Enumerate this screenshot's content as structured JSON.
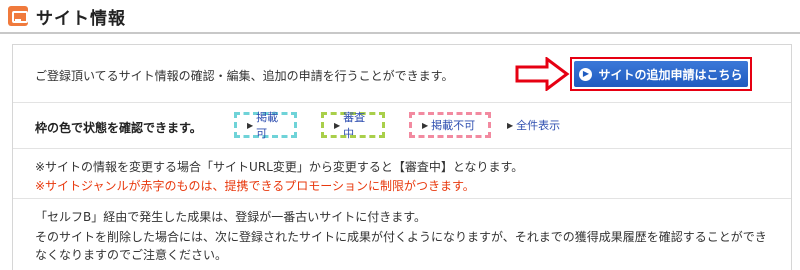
{
  "header": {
    "title": "サイト情報",
    "icon": "site-window-icon"
  },
  "colors": {
    "accent": "#f07a3c",
    "button": "#2a66cc",
    "highlight_border": "#e60012",
    "warning_text": "#e8380d",
    "link": "#2f4fb0",
    "status_ok": "#6fd3d8",
    "status_review": "#a9cf4a",
    "status_ng": "#f28aa0"
  },
  "intro": {
    "text": "ご登録頂いてるサイト情報の確認・編集、追加の申請を行うことができます。",
    "apply_button_label": "サイトの追加申請はこちら",
    "apply_button_icon": "circle-arrow-right-icon"
  },
  "status_filter": {
    "label": "枠の色で状態を確認できます。",
    "items": [
      {
        "label": "掲載可"
      },
      {
        "label": "審査中"
      },
      {
        "label": "掲載不可"
      },
      {
        "label": "全件表示"
      }
    ],
    "marker": "▶"
  },
  "notes": {
    "change_note": "※サイトの情報を変更する場合「サイトURL変更」から変更すると【審査中】となります。",
    "genre_note": "※サイトジャンルが赤字のものは、提携できるプロモーションに制限がつきます。"
  },
  "info": {
    "line1": "「セルフB」経由で発生した成果は、登録が一番古いサイトに付きます。",
    "line2": "そのサイトを削除した場合には、次に登録されたサイトに成果が付くようになりますが、それまでの獲得成果履歴を確認することができ",
    "line3": "なくなりますのでご注意ください。"
  }
}
